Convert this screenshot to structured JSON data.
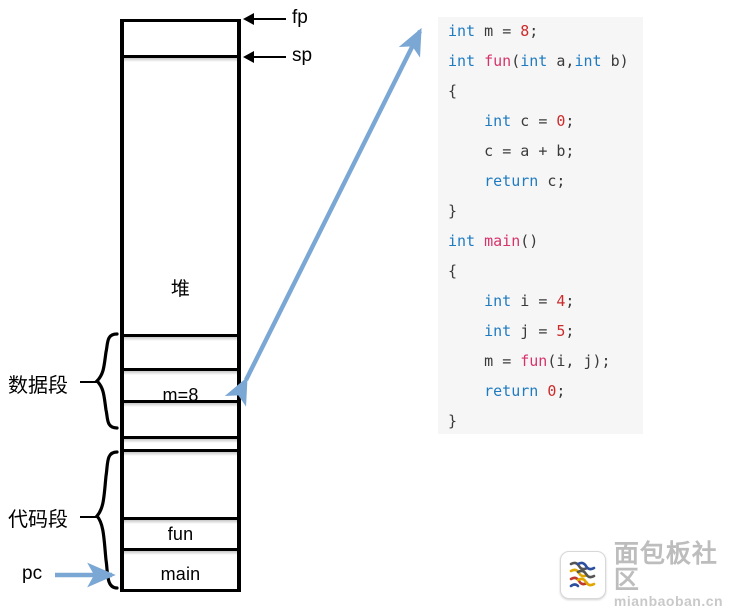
{
  "diagram": {
    "title": "C program memory layout with source code",
    "pointers": [
      {
        "name": "fp",
        "label": "fp"
      },
      {
        "name": "sp",
        "label": "sp"
      },
      {
        "name": "pc",
        "label": "pc"
      }
    ],
    "regions": [
      {
        "name": "heap",
        "label": "堆"
      },
      {
        "name": "data-segment",
        "label": "数据段"
      },
      {
        "name": "code-segment",
        "label": "代码段"
      }
    ],
    "cells": [
      {
        "name": "data-variable",
        "label": "m=8"
      },
      {
        "name": "code-fun",
        "label": "fun"
      },
      {
        "name": "code-main",
        "label": "main"
      }
    ]
  },
  "code": {
    "language": "c",
    "lines": [
      "int m = 8;",
      "int fun(int a,int b)",
      "{",
      "    int c = 0;",
      "    c = a + b;",
      "    return c;",
      "}",
      "int main()",
      "{",
      "    int i = 4;",
      "    int j = 5;",
      "    m = fun(i, j);",
      "    return 0;",
      "}"
    ]
  },
  "colors": {
    "keyword": "#1f7bc0",
    "function": "#d6336c",
    "number": "#cc2b2b",
    "panel_bg": "#f6f6f6",
    "arrow_blue": "#7ba7d4",
    "stroke": "#000000"
  },
  "watermark": {
    "name_cn": "面包板社区",
    "name_en": "mianbaoban.cn"
  }
}
